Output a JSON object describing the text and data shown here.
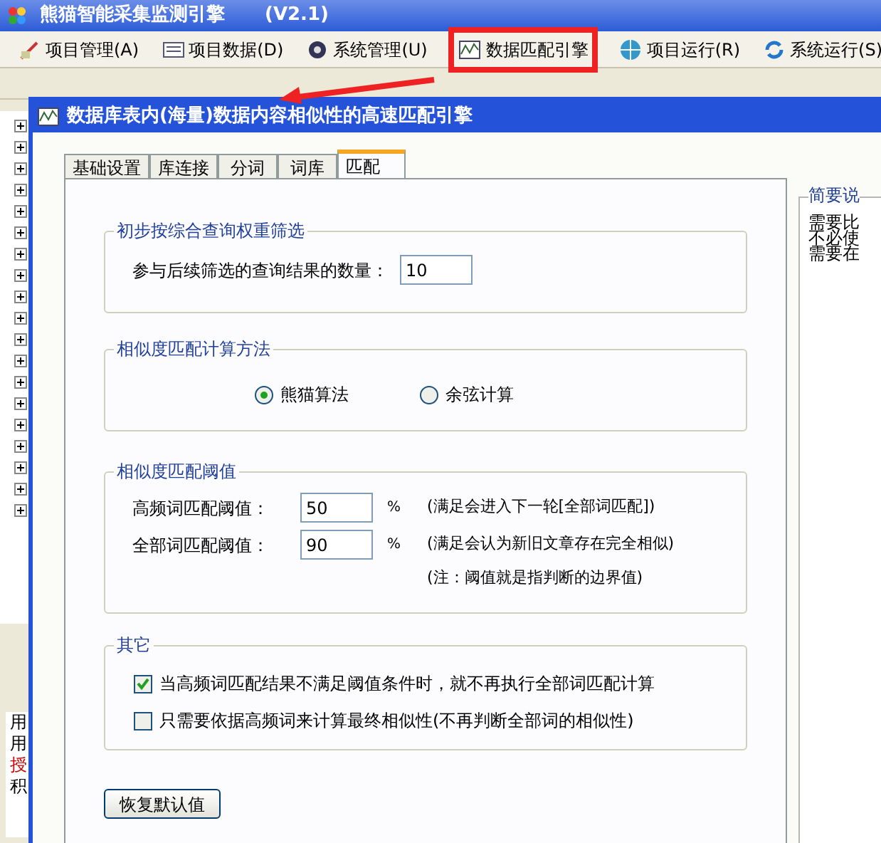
{
  "app": {
    "title": "熊猫智能采集监测引擎",
    "version": "(V2.1)",
    "menu": [
      {
        "label": "项目管理(A)",
        "kind": "tools",
        "selected": false
      },
      {
        "label": "项目数据(D)",
        "kind": "list",
        "selected": false
      },
      {
        "label": "系统管理(U)",
        "kind": "gear",
        "selected": false
      },
      {
        "label": "数据匹配引擎",
        "kind": "chart",
        "selected": true
      },
      {
        "label": "项目运行(R)",
        "kind": "globe",
        "selected": false
      },
      {
        "label": "系统运行(S)",
        "kind": "sync",
        "selected": false
      }
    ],
    "tree": [
      {
        "expanded": false
      },
      {
        "expanded": false
      },
      {
        "expanded": false
      },
      {
        "expanded": false
      },
      {
        "expanded": false
      },
      {
        "expanded": false
      },
      {
        "expanded": false
      },
      {
        "expanded": false
      },
      {
        "expanded": false
      },
      {
        "expanded": false
      },
      {
        "expanded": false
      },
      {
        "expanded": false
      },
      {
        "expanded": false
      },
      {
        "expanded": false
      },
      {
        "expanded": false
      },
      {
        "expanded": false
      },
      {
        "expanded": false
      },
      {
        "expanded": false
      },
      {
        "expanded": false
      }
    ],
    "info_lines": [
      {
        "text": "用",
        "color": "#000000"
      },
      {
        "text": "用",
        "color": "#000000"
      },
      {
        "text": "授",
        "color": "#cc0000"
      },
      {
        "text": "积",
        "color": "#000000"
      }
    ]
  },
  "dialog": {
    "title": "数据库表内(海量)数据内容相似性的高速匹配引擎",
    "tabs": [
      {
        "label": "基础设置",
        "selected": false
      },
      {
        "label": "库连接",
        "selected": false
      },
      {
        "label": "分词",
        "selected": false
      },
      {
        "label": "词库",
        "selected": false
      },
      {
        "label": "匹配",
        "selected": true
      }
    ],
    "filter_group": {
      "title": "初步按综合查询权重筛选",
      "label": "参与后续筛选的查询结果的数量：",
      "value": "10"
    },
    "method_group": {
      "title": "相似度匹配计算方法",
      "options": [
        {
          "label": "熊猫算法",
          "selected": true
        },
        {
          "label": "余弦计算",
          "selected": false
        }
      ]
    },
    "threshold_group": {
      "title": "相似度匹配阈值",
      "rows": [
        {
          "label": "高频词匹配阈值：",
          "value": "50",
          "unit": "%",
          "note": "(满足会进入下一轮[全部词匹配])"
        },
        {
          "label": "全部词匹配阈值：",
          "value": "90",
          "unit": "%",
          "note": "(满足会认为新旧文章存在完全相似)"
        }
      ],
      "footnote": "(注：阈值就是指判断的边界值)"
    },
    "other_group": {
      "title": "其它",
      "options": [
        {
          "label": "当高频词匹配结果不满足阈值条件时，就不再执行全部词匹配计算",
          "checked": true
        },
        {
          "label": "只需要依据高频词来计算最终相似性(不再判断全部词的相似性)",
          "checked": false
        }
      ]
    },
    "reset_button": "恢复默认值",
    "side_panel": {
      "title": "简要说",
      "lines": [
        "需要比",
        "不必使",
        "需要在"
      ]
    }
  }
}
